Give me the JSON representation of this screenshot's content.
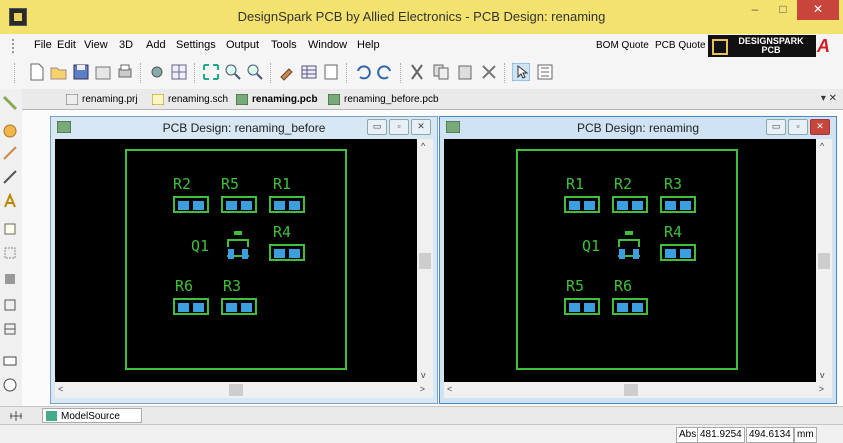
{
  "window": {
    "title": "DesignSpark PCB by Allied Electronics - PCB Design: renaming",
    "min": "–",
    "max": "□",
    "close": "✕"
  },
  "menu": [
    {
      "label": "File"
    },
    {
      "label": "Edit"
    },
    {
      "label": "View"
    },
    {
      "label": "3D"
    },
    {
      "label": "Add"
    },
    {
      "label": "Settings"
    },
    {
      "label": "Output"
    },
    {
      "label": "Tools"
    },
    {
      "label": "Window"
    },
    {
      "label": "Help"
    }
  ],
  "quotes": {
    "bom": "BOM Quote",
    "pcb": "PCB Quote"
  },
  "branding": {
    "logo_line1": "DESIGNSPARK",
    "logo_line2": "PCB",
    "logo_mark": "A"
  },
  "doc_tabs": [
    {
      "label": "renaming.prj"
    },
    {
      "label": "renaming.sch"
    },
    {
      "label": "renaming.pcb"
    },
    {
      "label": "renaming_before.pcb"
    }
  ],
  "tab_pin": "▾ ✕",
  "left_window": {
    "title": "PCB Design: renaming_before",
    "refs": {
      "r2": "R2",
      "r5": "R5",
      "r1": "R1",
      "r4": "R4",
      "q1": "Q1",
      "r6": "R6",
      "r3": "R3"
    }
  },
  "right_window": {
    "title": "PCB Design: renaming",
    "refs": {
      "r1": "R1",
      "r2": "R2",
      "r3": "R3",
      "r4": "R4",
      "q1": "Q1",
      "r5": "R5",
      "r6": "R6"
    }
  },
  "bottom_tab": "ModelSource",
  "status": {
    "mode": "Abs",
    "x": "481.9254",
    "y": "494.6134",
    "unit": "mm"
  },
  "colors": {
    "title_bar": "#f3e36e",
    "pcb_outline": "#3fbf3a",
    "pad": "#3c9fe0",
    "canvas": "#000000",
    "close_btn": "#c7453a"
  }
}
